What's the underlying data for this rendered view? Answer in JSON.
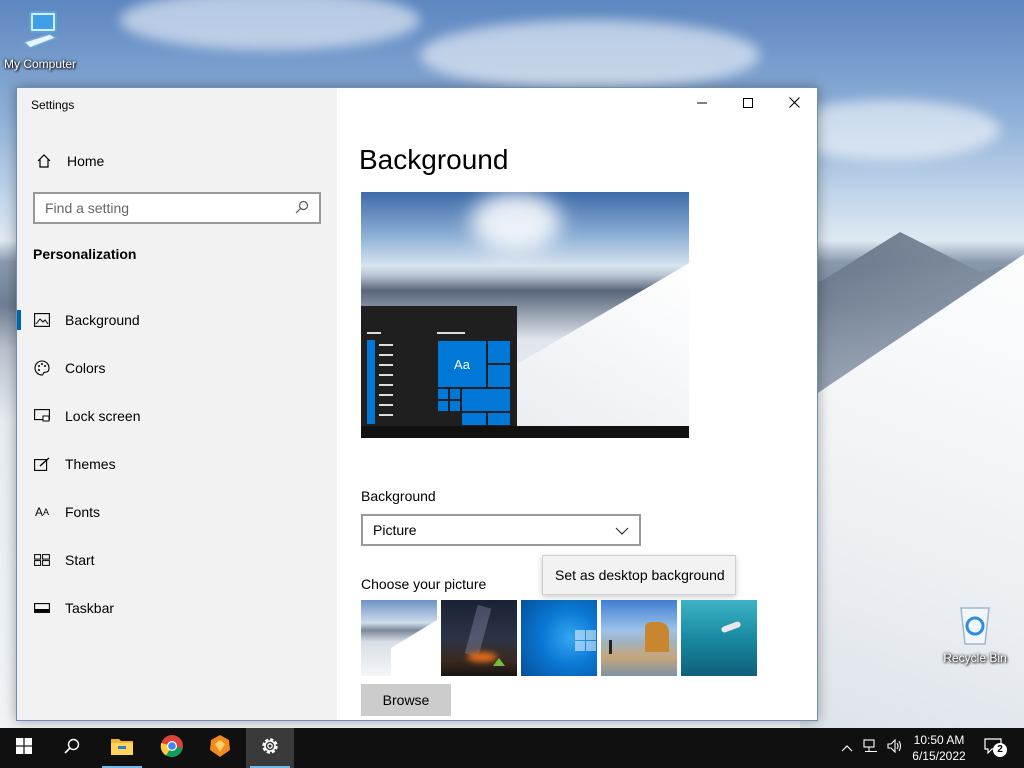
{
  "desktop": {
    "icons": [
      {
        "label": "My Computer",
        "icon": "computer-icon"
      },
      {
        "label": "Recycle Bin",
        "icon": "recycle-bin-icon"
      }
    ]
  },
  "window": {
    "title": "Settings",
    "caption": {
      "minimize": "minimize-icon",
      "maximize": "maximize-icon",
      "close": "close-icon"
    }
  },
  "sidebar": {
    "home_label": "Home",
    "search_placeholder": "Find a setting",
    "section_title": "Personalization",
    "items": [
      {
        "label": "Background",
        "icon": "picture-icon",
        "active": true
      },
      {
        "label": "Colors",
        "icon": "palette-icon",
        "active": false
      },
      {
        "label": "Lock screen",
        "icon": "lock-screen-icon",
        "active": false
      },
      {
        "label": "Themes",
        "icon": "themes-icon",
        "active": false
      },
      {
        "label": "Fonts",
        "icon": "fonts-icon",
        "active": false
      },
      {
        "label": "Start",
        "icon": "start-icon",
        "active": false
      },
      {
        "label": "Taskbar",
        "icon": "taskbar-icon",
        "active": false
      }
    ]
  },
  "main": {
    "title": "Background",
    "preview": {
      "sample_text": "Aa"
    },
    "background_label": "Background",
    "background_value": "Picture",
    "tooltip": "Set as desktop background",
    "choose_label": "Choose your picture",
    "thumbnails": [
      "snow-mountain",
      "night-sky-tent",
      "windows-blue",
      "beach-rocks",
      "underwater-swimmer"
    ],
    "browse_label": "Browse"
  },
  "taskbar": {
    "apps": [
      "start-icon",
      "search-icon",
      "file-explorer-icon",
      "chrome-icon",
      "app-icon",
      "settings-icon"
    ],
    "time": "10:50 AM",
    "date": "6/15/2022",
    "notification_count": "2",
    "accent": "#0078d7"
  }
}
